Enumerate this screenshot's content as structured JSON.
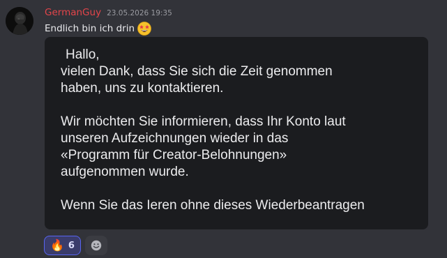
{
  "message": {
    "author": "GermanGuy",
    "author_color": "#e3454a",
    "timestamp": "23.05.2026 19:35",
    "text": "Endlich bin ich drin",
    "text_emoji": "star-struck-emoji"
  },
  "embed": {
    "lines_p1": [
      "Hallo,",
      "vielen Dank, dass Sie sich die Zeit genommen",
      "haben, uns zu kontaktieren."
    ],
    "lines_p2": [
      "Wir möchten Sie informieren, dass Ihr Konto laut",
      "unseren Aufzeichnungen wieder in das",
      "«Programm für Creator-Belohnungen»",
      "aufgenommen wurde."
    ],
    "line_cut": "Wenn Sie das Ieren ohne dieses Wiederbeantragen"
  },
  "reactions": [
    {
      "emoji": "🔥",
      "icon": "fire-icon",
      "count": "6",
      "active": true
    }
  ],
  "add_reaction_icon": "smile-plus-icon",
  "colors": {
    "background": "#323339",
    "embed_background": "#1b1c1f",
    "reaction_active_bg": "#3a3c6b",
    "reaction_active_border": "#5865f2"
  }
}
